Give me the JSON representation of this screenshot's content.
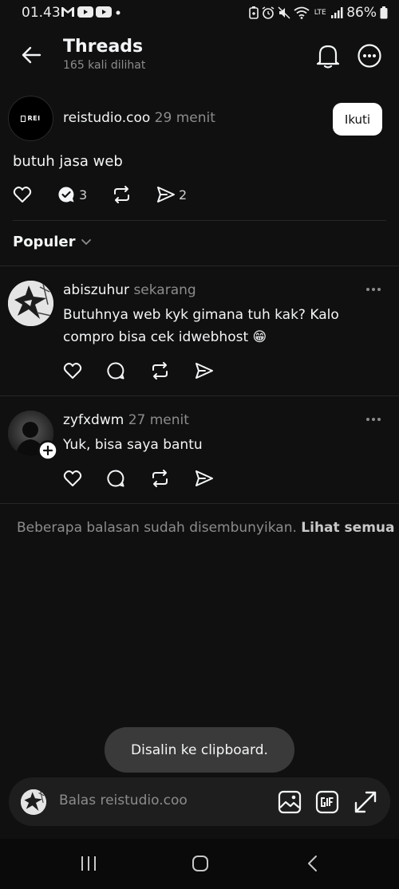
{
  "status_bar": {
    "time": "01.43",
    "battery": "86%",
    "network": "LTE"
  },
  "header": {
    "title": "Threads",
    "subtitle": "165 kali dilihat"
  },
  "post": {
    "avatar_label": "REI",
    "username": "reistudio.coo",
    "time": "29 menit",
    "follow_label": "Ikuti",
    "text": "butuh jasa web",
    "reply_count": "3",
    "share_count": "2"
  },
  "sort": {
    "label": "Populer"
  },
  "replies": [
    {
      "username": "abiszuhur",
      "time": "sekarang",
      "text": "Butuhnya web kyk gimana tuh kak? Kalo compro bisa cek idwebhost 😁"
    },
    {
      "username": "zyfxdwm",
      "time": "27 menit",
      "text": "Yuk, bisa saya bantu"
    }
  ],
  "hidden_note": {
    "text": "Beberapa balasan sudah disembunyikan.",
    "link": "Lihat semua"
  },
  "toast": {
    "text": "Disalin ke clipboard."
  },
  "reply_bar": {
    "placeholder": "Balas reistudio.coo"
  },
  "colors": {
    "background": "#101010",
    "text": "#f3f5f7",
    "muted": "#8c8c8c",
    "divider": "#262626",
    "follow_bg": "#ffffff",
    "toast_bg": "#3a3a3a"
  }
}
